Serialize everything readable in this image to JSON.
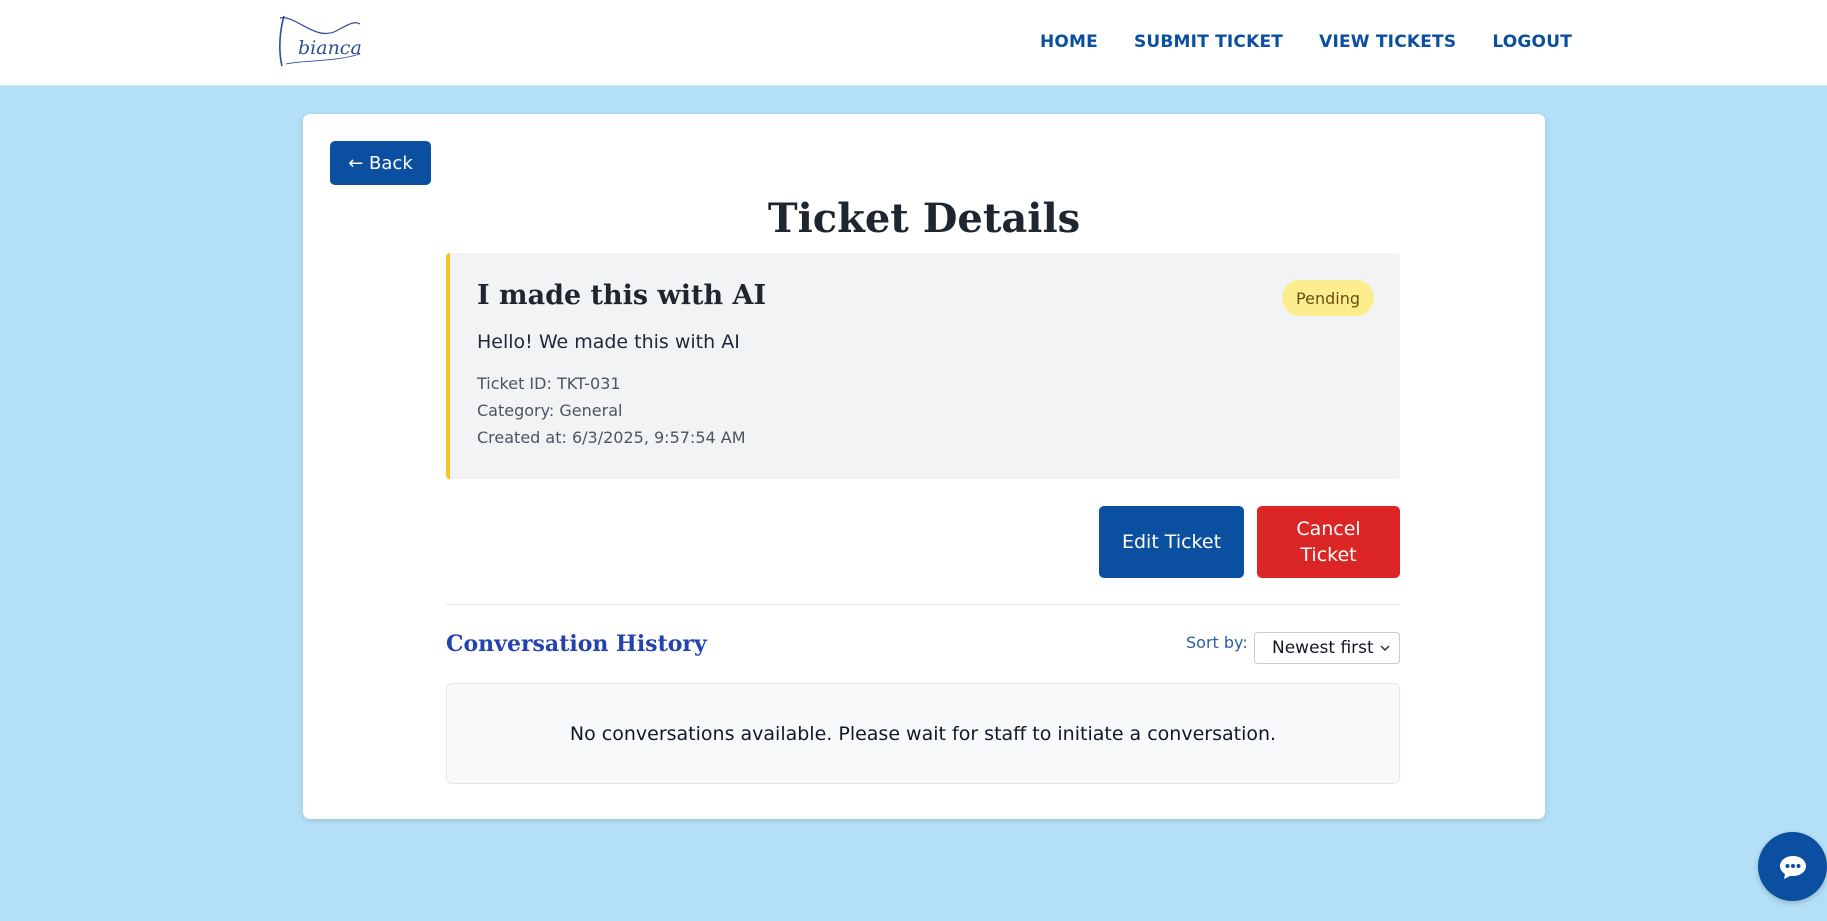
{
  "nav": {
    "items": [
      {
        "label": "HOME"
      },
      {
        "label": "SUBMIT TICKET"
      },
      {
        "label": "VIEW TICKETS"
      },
      {
        "label": "LOGOUT"
      }
    ]
  },
  "back_label": "← Back",
  "page_title": "Ticket Details",
  "ticket": {
    "title": "I made this with AI",
    "status": "Pending",
    "description": "Hello! We made this with AI",
    "id_line": "Ticket ID: TKT-031",
    "category_line": "Category: General",
    "created_line": "Created at: 6/3/2025, 9:57:54 AM"
  },
  "actions": {
    "edit_label": "Edit Ticket",
    "cancel_label": "Cancel Ticket"
  },
  "conversation": {
    "title": "Conversation History",
    "sort_label": "Sort by:",
    "sort_value": "Newest first",
    "empty_message": "No conversations available. Please wait for staff to initiate a conversation."
  },
  "colors": {
    "brand": "#0a4fa0",
    "background": "#b3dff7",
    "danger": "#dc2626",
    "pending_badge": "#fcee8f",
    "ticket_accent": "#f3c623"
  },
  "icons": {
    "logo": "bianca-logo",
    "chat": "chat-bubble-icon",
    "chevron": "chevron-down-icon"
  }
}
